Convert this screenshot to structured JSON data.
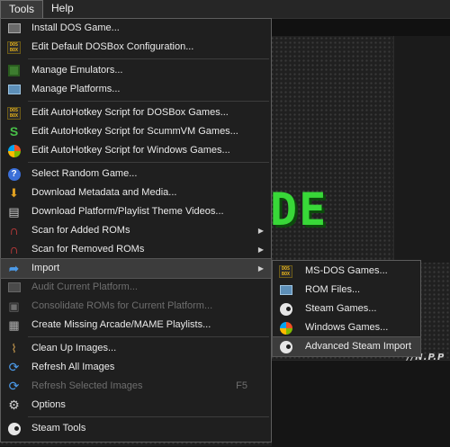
{
  "menubar": {
    "items": [
      "Tools",
      "Help"
    ]
  },
  "background": {
    "big_text": "DE",
    "small_text": "//N.P.P"
  },
  "tools_menu": {
    "groups": [
      [
        {
          "label": "Install DOS Game...",
          "icon": "install-icon"
        },
        {
          "label": "Edit Default DOSBox Configuration...",
          "icon": "dosbox-icon"
        }
      ],
      [
        {
          "label": "Manage Emulators...",
          "icon": "chip-icon"
        },
        {
          "label": "Manage Platforms...",
          "icon": "monitor-icon"
        }
      ],
      [
        {
          "label": "Edit AutoHotkey Script for DOSBox Games...",
          "icon": "dosbox-icon"
        },
        {
          "label": "Edit AutoHotkey Script for ScummVM Games...",
          "icon": "scummvm-icon"
        },
        {
          "label": "Edit AutoHotkey Script for Windows Games...",
          "icon": "windows-icon"
        }
      ],
      [
        {
          "label": "Select Random Game...",
          "icon": "question-icon"
        },
        {
          "label": "Download Metadata and Media...",
          "icon": "download-icon"
        },
        {
          "label": "Download Platform/Playlist Theme Videos...",
          "icon": "film-icon"
        },
        {
          "label": "Scan for Added ROMs",
          "icon": "magnet-icon",
          "submenu": true
        },
        {
          "label": "Scan for Removed ROMs",
          "icon": "magnet-icon",
          "submenu": true
        },
        {
          "label": "Import",
          "icon": "import-arrow-icon",
          "submenu": true,
          "highlight": true
        },
        {
          "label": "Audit Current Platform...",
          "icon": "audit-icon",
          "disabled": true
        },
        {
          "label": "Consolidate ROMs for Current Platform...",
          "icon": "consolidate-icon",
          "disabled": true
        },
        {
          "label": "Create Missing Arcade/MAME Playlists...",
          "icon": "playlist-icon"
        }
      ],
      [
        {
          "label": "Clean Up Images...",
          "icon": "broom-icon"
        },
        {
          "label": "Refresh All Images",
          "icon": "refresh-icon"
        },
        {
          "label": "Refresh Selected Images",
          "icon": "refresh-icon",
          "disabled": true,
          "shortcut": "F5"
        },
        {
          "label": "Options",
          "icon": "gear-icon"
        }
      ],
      [
        {
          "label": "Steam Tools",
          "icon": "steam-icon"
        }
      ]
    ]
  },
  "import_submenu": {
    "items": [
      {
        "label": "MS-DOS Games...",
        "icon": "dosbox-icon"
      },
      {
        "label": "ROM Files...",
        "icon": "monitor-icon"
      },
      {
        "label": "Steam Games...",
        "icon": "steam-icon"
      },
      {
        "label": "Windows Games...",
        "icon": "windows-icon"
      },
      {
        "label": "Advanced Steam Import",
        "icon": "steam-icon",
        "highlight": true
      }
    ]
  }
}
